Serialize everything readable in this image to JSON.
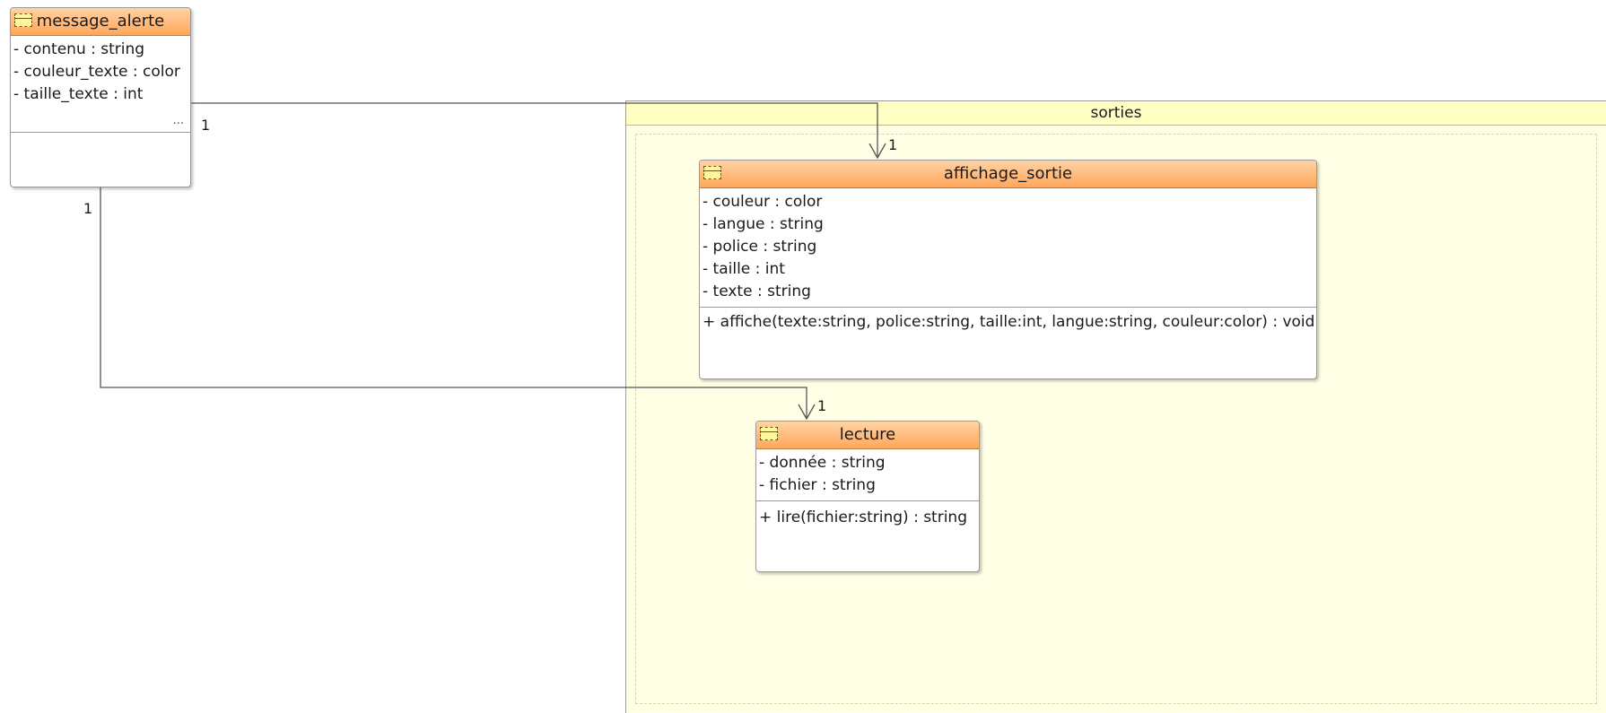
{
  "package": {
    "name": "sorties"
  },
  "classes": {
    "message_alerte": {
      "name": "message_alerte",
      "attributes": [
        "- contenu : string",
        "- couleur_texte : color",
        "- taille_texte : int"
      ],
      "overflow_marker": "...",
      "methods": []
    },
    "affichage_sortie": {
      "name": "affichage_sortie",
      "attributes": [
        "- couleur : color",
        "- langue : string",
        "- police : string",
        "- taille : int",
        "- texte : string"
      ],
      "methods": [
        "+ affiche(texte:string, police:string, taille:int, langue:string, couleur:color) : void"
      ]
    },
    "lecture": {
      "name": "lecture",
      "attributes": [
        "- donnée : string",
        "- fichier : string"
      ],
      "methods": [
        "+ lire(fichier:string) : string"
      ]
    }
  },
  "associations": [
    {
      "from": "message_alerte",
      "to": "affichage_sortie",
      "source_multiplicity": "1",
      "target_multiplicity": "1",
      "navigable": "to"
    },
    {
      "from": "message_alerte",
      "to": "lecture",
      "source_multiplicity": "1",
      "target_multiplicity": "1",
      "navigable": "to"
    }
  ],
  "colors": {
    "class_header": "#ffa75a",
    "package_body": "#ffffe6",
    "package_header": "#ffffc4",
    "edge": "#555555"
  }
}
